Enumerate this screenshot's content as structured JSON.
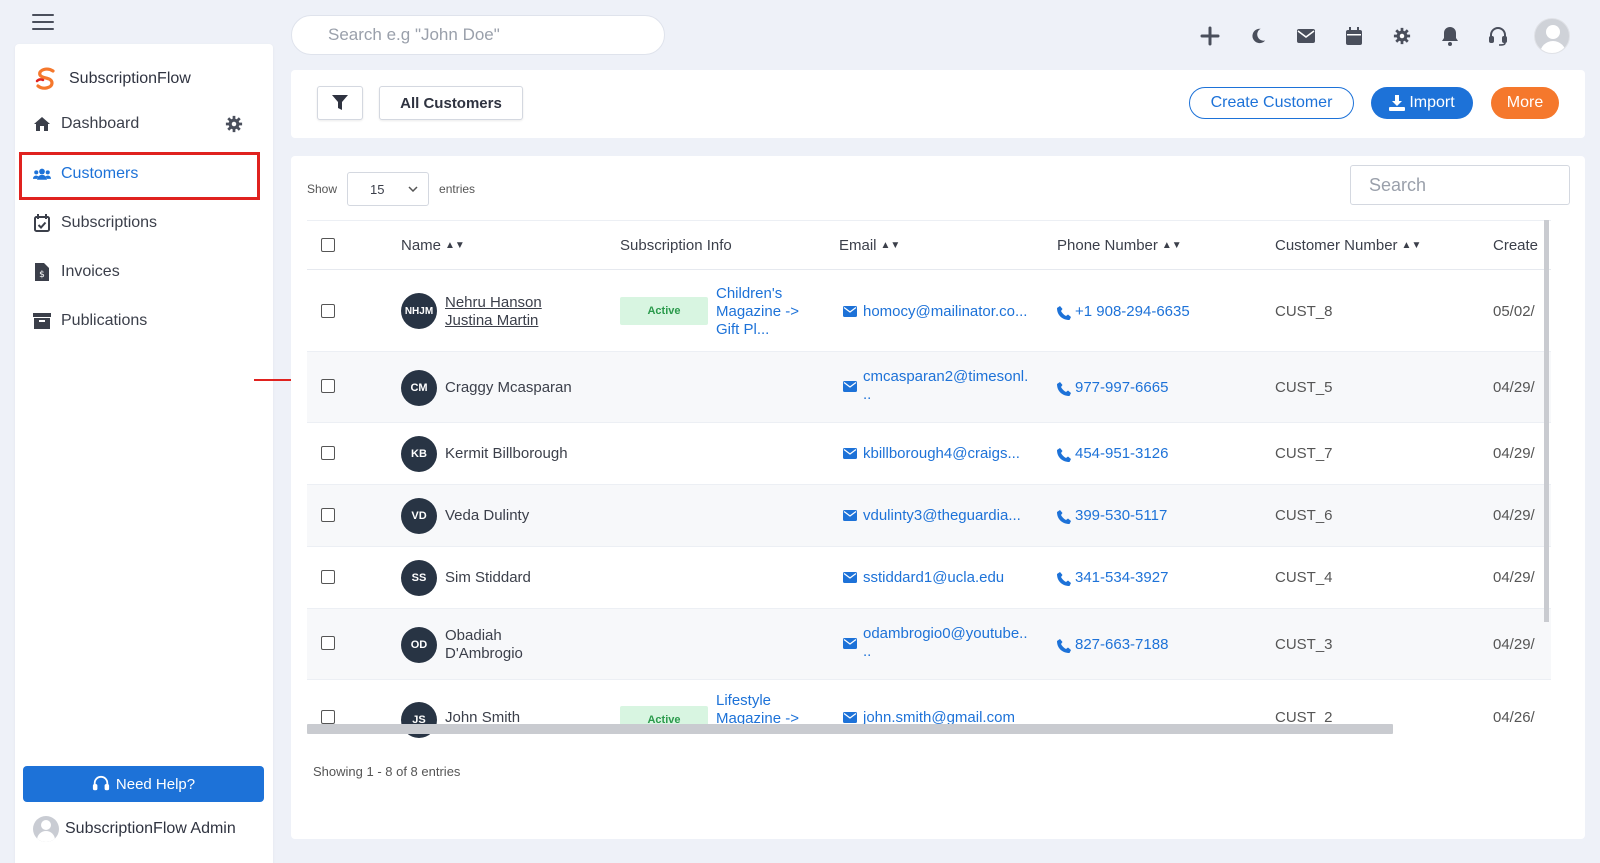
{
  "header": {
    "search_placeholder": "Search e.g \"John Doe\"",
    "icons": [
      "plus-icon",
      "moon-icon",
      "mail-icon",
      "calendar-icon",
      "gear-icon",
      "bell-icon",
      "headset-icon"
    ]
  },
  "sidebar": {
    "brand": "SubscriptionFlow",
    "items": [
      {
        "label": "Dashboard",
        "icon": "home-icon"
      },
      {
        "label": "Customers",
        "icon": "users-icon",
        "active": true
      },
      {
        "label": "Subscriptions",
        "icon": "calendar-check-icon"
      },
      {
        "label": "Invoices",
        "icon": "invoice-icon"
      },
      {
        "label": "Publications",
        "icon": "archive-icon"
      }
    ],
    "help_label": "Need Help?",
    "admin_name": "SubscriptionFlow Admin"
  },
  "toolbar": {
    "view_label": "All Customers",
    "create_label": "Create Customer",
    "import_label": "Import",
    "more_label": "More"
  },
  "table": {
    "show_label": "Show",
    "entries_label": "entries",
    "page_size": "15",
    "search_placeholder": "Search",
    "columns": [
      "Name",
      "Subscription Info",
      "Email",
      "Phone Number",
      "Customer Number",
      "Create"
    ],
    "rows": [
      {
        "initials": "NHJM",
        "name": "Nehru Hanson Justina Martin",
        "name_line1": "Nehru Hanson",
        "name_line2": "Justina Martin",
        "status": "Active",
        "plan_line1": "Children's",
        "plan_line2": "Magazine ->",
        "plan_line3": "Gift Pl...",
        "email_line1": "homocy@mailinator.co...",
        "email_line2": "",
        "phone": "+1 908-294-6635",
        "customer_number": "CUST_8",
        "created": "05/02/"
      },
      {
        "initials": "CM",
        "name": "Craggy Mcasparan",
        "name_line1": "Craggy Mcasparan",
        "name_line2": "",
        "status": "",
        "plan_line1": "",
        "plan_line2": "",
        "plan_line3": "",
        "email_line1": "cmcasparan2@timesonl.",
        "email_line2": "..",
        "phone": "977-997-6665",
        "customer_number": "CUST_5",
        "created": "04/29/"
      },
      {
        "initials": "KB",
        "name": "Kermit Billborough",
        "name_line1": "Kermit Billborough",
        "name_line2": "",
        "status": "",
        "plan_line1": "",
        "plan_line2": "",
        "plan_line3": "",
        "email_line1": "kbillborough4@craigs...",
        "email_line2": "",
        "phone": "454-951-3126",
        "customer_number": "CUST_7",
        "created": "04/29/"
      },
      {
        "initials": "VD",
        "name": "Veda Dulinty",
        "name_line1": "Veda Dulinty",
        "name_line2": "",
        "status": "",
        "plan_line1": "",
        "plan_line2": "",
        "plan_line3": "",
        "email_line1": "vdulinty3@theguardia...",
        "email_line2": "",
        "phone": "399-530-5117",
        "customer_number": "CUST_6",
        "created": "04/29/"
      },
      {
        "initials": "SS",
        "name": "Sim Stiddard",
        "name_line1": "Sim Stiddard",
        "name_line2": "",
        "status": "",
        "plan_line1": "",
        "plan_line2": "",
        "plan_line3": "",
        "email_line1": "sstiddard1@ucla.edu",
        "email_line2": "",
        "phone": "341-534-3927",
        "customer_number": "CUST_4",
        "created": "04/29/"
      },
      {
        "initials": "OD",
        "name": "Obadiah D'Ambrogio",
        "name_line1": "Obadiah",
        "name_line2": "D'Ambrogio",
        "status": "",
        "plan_line1": "",
        "plan_line2": "",
        "plan_line3": "",
        "email_line1": "odambrogio0@youtube..",
        "email_line2": "..",
        "phone": "827-663-7188",
        "customer_number": "CUST_3",
        "created": "04/29/"
      },
      {
        "initials": "JS",
        "name": "John Smith",
        "name_line1": "John Smith",
        "name_line2": "",
        "status": "Active",
        "plan_line1": "Lifestyle",
        "plan_line2": "Magazine ->",
        "plan_line3": "",
        "email_line1": "john.smith@gmail.com",
        "email_line2": "",
        "phone": "",
        "customer_number": "CUST_2",
        "created": "04/26/"
      }
    ],
    "footer": "Showing 1 - 8 of 8 entries"
  },
  "colors": {
    "accent": "#1d72d8",
    "orange": "#f5782c",
    "highlight": "#e0221f",
    "badge_bg": "#d8f5e1",
    "avatar_bg": "#283444"
  }
}
